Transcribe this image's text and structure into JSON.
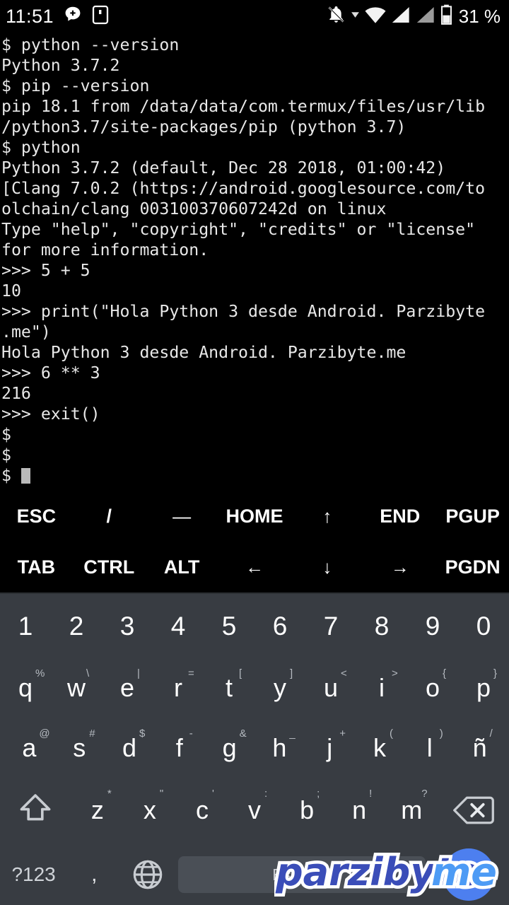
{
  "status_bar": {
    "time": "11:51",
    "battery_text": "31 %",
    "left_icons": [
      "message-plus-icon",
      "app-window-icon"
    ],
    "right_icons": [
      "notifications-off-icon",
      "dropdown-caret-icon",
      "wifi-icon",
      "signal-sim1-icon",
      "signal-sim2-icon",
      "battery-icon"
    ],
    "colors": {
      "background": "#000000",
      "foreground": "#ffffff"
    }
  },
  "terminal": {
    "app": "Termux",
    "colors": {
      "background": "#000000",
      "foreground": "#e8e8e8",
      "cursor": "#b9b9b9"
    },
    "lines": [
      "$ python --version",
      "Python 3.7.2",
      "$ pip --version",
      "pip 18.1 from /data/data/com.termux/files/usr/lib",
      "/python3.7/site-packages/pip (python 3.7)",
      "$ python",
      "Python 3.7.2 (default, Dec 28 2018, 01:00:42)",
      "[Clang 7.0.2 (https://android.googlesource.com/to",
      "olchain/clang 003100370607242d on linux",
      "Type \"help\", \"copyright\", \"credits\" or \"license\"",
      "for more information.",
      ">>> 5 + 5",
      "10",
      ">>> print(\"Hola Python 3 desde Android. Parzibyte",
      ".me\")",
      "Hola Python 3 desde Android. Parzibyte.me",
      ">>> 6 ** 3",
      "216",
      ">>> exit()",
      "$",
      "$"
    ],
    "prompt_last": "$"
  },
  "extra_keys": {
    "row1": [
      "ESC",
      "/",
      "—",
      "HOME",
      "↑",
      "END",
      "PGUP"
    ],
    "row2": [
      "TAB",
      "CTRL",
      "ALT",
      "←",
      "↓",
      "→",
      "PGDN"
    ]
  },
  "keyboard": {
    "language_label": "Español",
    "symbols_key": "?123",
    "comma_key": ",",
    "background_color": "#383c42",
    "enter_color": "#4d7fef",
    "number_row": [
      "1",
      "2",
      "3",
      "4",
      "5",
      "6",
      "7",
      "8",
      "9",
      "0"
    ],
    "row_q": [
      {
        "key": "q",
        "hint": "%"
      },
      {
        "key": "w",
        "hint": "\\"
      },
      {
        "key": "e",
        "hint": "|"
      },
      {
        "key": "r",
        "hint": "="
      },
      {
        "key": "t",
        "hint": "["
      },
      {
        "key": "y",
        "hint": "]"
      },
      {
        "key": "u",
        "hint": "<"
      },
      {
        "key": "i",
        "hint": ">"
      },
      {
        "key": "o",
        "hint": "{"
      },
      {
        "key": "p",
        "hint": "}"
      }
    ],
    "row_a": [
      {
        "key": "a",
        "hint": "@"
      },
      {
        "key": "s",
        "hint": "#"
      },
      {
        "key": "d",
        "hint": "$"
      },
      {
        "key": "f",
        "hint": "-"
      },
      {
        "key": "g",
        "hint": "&"
      },
      {
        "key": "h",
        "hint": "_"
      },
      {
        "key": "j",
        "hint": "+"
      },
      {
        "key": "k",
        "hint": "("
      },
      {
        "key": "l",
        "hint": ")"
      },
      {
        "key": "ñ",
        "hint": "/"
      }
    ],
    "row_z": [
      {
        "key": "z",
        "hint": "*"
      },
      {
        "key": "x",
        "hint": "\""
      },
      {
        "key": "c",
        "hint": "'"
      },
      {
        "key": "v",
        "hint": ":"
      },
      {
        "key": "b",
        "hint": ";"
      },
      {
        "key": "n",
        "hint": "!"
      },
      {
        "key": "m",
        "hint": "?"
      }
    ],
    "shift_icon": "shift-arrow-icon",
    "backspace_icon": "backspace-icon",
    "globe_icon": "globe-language-icon",
    "enter_icon": "enter-return-icon"
  },
  "watermark": {
    "text_main": "parzibyte",
    "text_dot": ".",
    "text_tld": "me",
    "color_main": "#3a4db8",
    "color_tld": "#4d9bf5"
  }
}
